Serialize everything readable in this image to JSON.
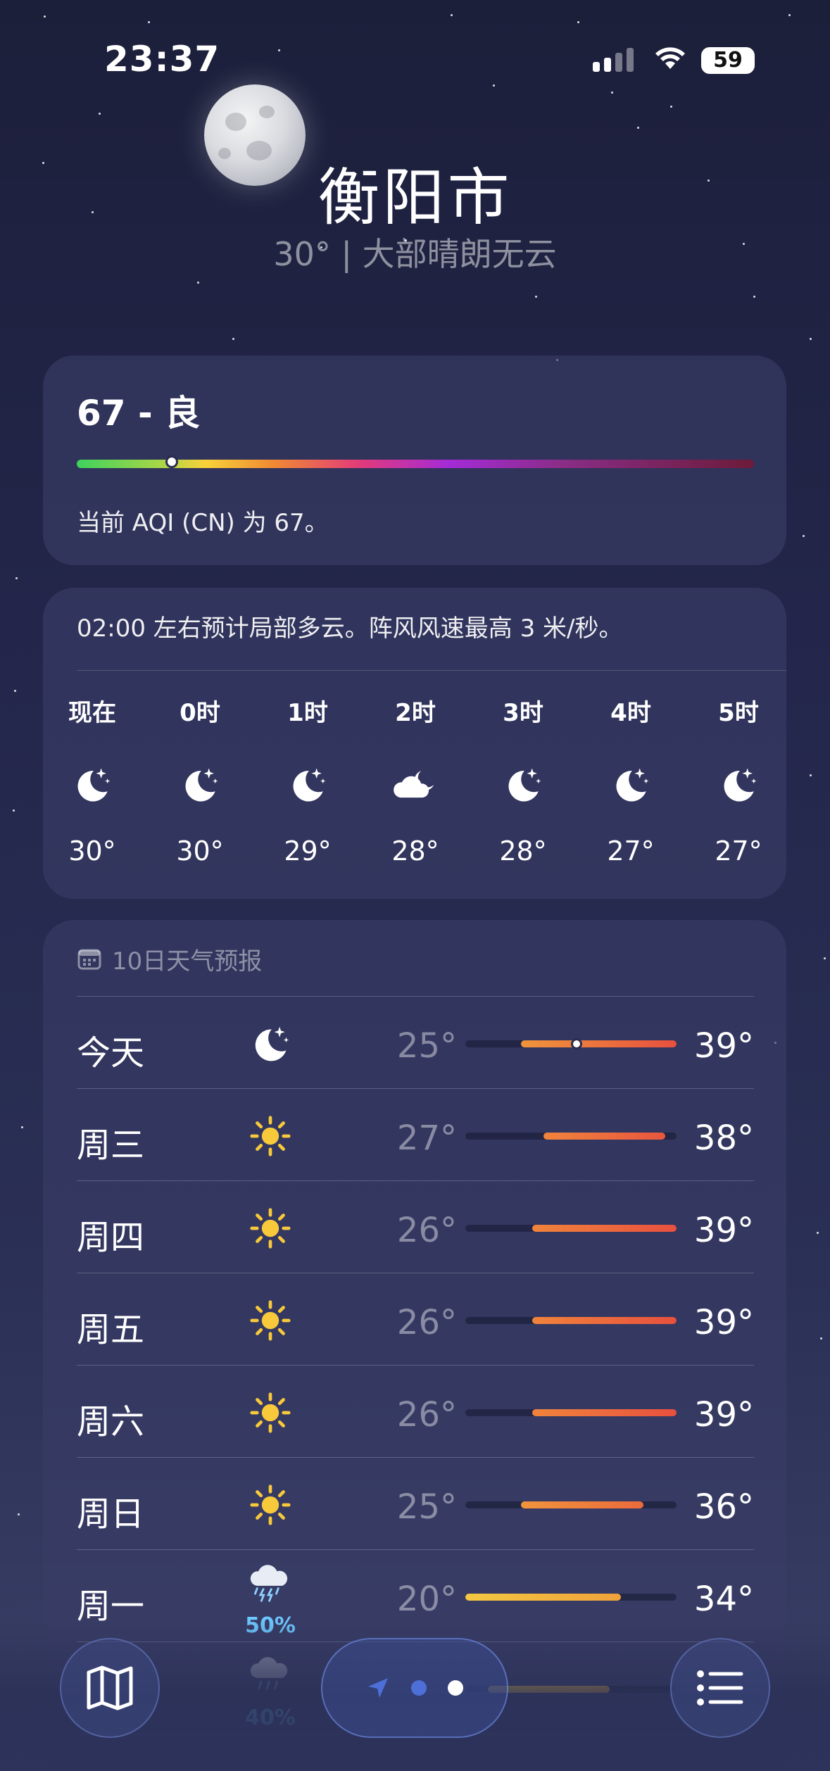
{
  "status_bar": {
    "time": "23:37",
    "battery": "59"
  },
  "header": {
    "city": "衡阳市",
    "condition": "30° | 大部晴朗无云"
  },
  "aqi": {
    "value_label": "67 - 良",
    "description": "当前 AQI (CN) 为 67。",
    "position": 0.14
  },
  "hourly": {
    "summary": "02:00 左右预计局部多云。阵风风速最高 3 米/秒。",
    "items": [
      {
        "label": "现在",
        "icon": "moon-stars-icon",
        "temp": "30°"
      },
      {
        "label": "0时",
        "icon": "moon-stars-icon",
        "temp": "30°"
      },
      {
        "label": "1时",
        "icon": "moon-stars-icon",
        "temp": "29°"
      },
      {
        "label": "2时",
        "icon": "cloud-moon-icon",
        "temp": "28°"
      },
      {
        "label": "3时",
        "icon": "moon-stars-icon",
        "temp": "28°"
      },
      {
        "label": "4时",
        "icon": "moon-stars-icon",
        "temp": "27°"
      },
      {
        "label": "5时",
        "icon": "moon-stars-icon",
        "temp": "27°"
      }
    ]
  },
  "daily": {
    "header": "10日天气预报",
    "range": [
      20,
      39
    ],
    "items": [
      {
        "day": "今天",
        "icon": "moon-stars-icon",
        "precip": "",
        "low": "25°",
        "high": "39°",
        "low_val": 25,
        "high_val": 39,
        "current_val": 30,
        "colors": [
          "#f0953c",
          "#e8503e"
        ]
      },
      {
        "day": "周三",
        "icon": "sun-icon",
        "precip": "",
        "low": "27°",
        "high": "38°",
        "low_val": 27,
        "high_val": 38,
        "colors": [
          "#f0843c",
          "#e8563e"
        ]
      },
      {
        "day": "周四",
        "icon": "sun-icon",
        "precip": "",
        "low": "26°",
        "high": "39°",
        "low_val": 26,
        "high_val": 39,
        "colors": [
          "#f0843c",
          "#e8503e"
        ]
      },
      {
        "day": "周五",
        "icon": "sun-icon",
        "precip": "",
        "low": "26°",
        "high": "39°",
        "low_val": 26,
        "high_val": 39,
        "colors": [
          "#f0843c",
          "#e8503e"
        ]
      },
      {
        "day": "周六",
        "icon": "sun-icon",
        "precip": "",
        "low": "26°",
        "high": "39°",
        "low_val": 26,
        "high_val": 39,
        "colors": [
          "#f0843c",
          "#e8503e"
        ]
      },
      {
        "day": "周日",
        "icon": "sun-icon",
        "precip": "",
        "low": "25°",
        "high": "36°",
        "low_val": 25,
        "high_val": 36,
        "colors": [
          "#f0953c",
          "#eb6a3c"
        ]
      },
      {
        "day": "周一",
        "icon": "cloud-rain-bolt-icon",
        "precip": "50%",
        "low": "20°",
        "high": "34°",
        "low_val": 20,
        "high_val": 34,
        "colors": [
          "#f3c842",
          "#f0a13a"
        ]
      },
      {
        "day": "",
        "icon": "cloud-rain-icon",
        "precip": "40%",
        "low": "",
        "high": "",
        "low_val": 22,
        "high_val": 33,
        "colors": [
          "#f3c842",
          "#f0b13a"
        ]
      }
    ]
  },
  "colors": {
    "accent": "#6cc7ff",
    "card": "#3a3e68"
  }
}
